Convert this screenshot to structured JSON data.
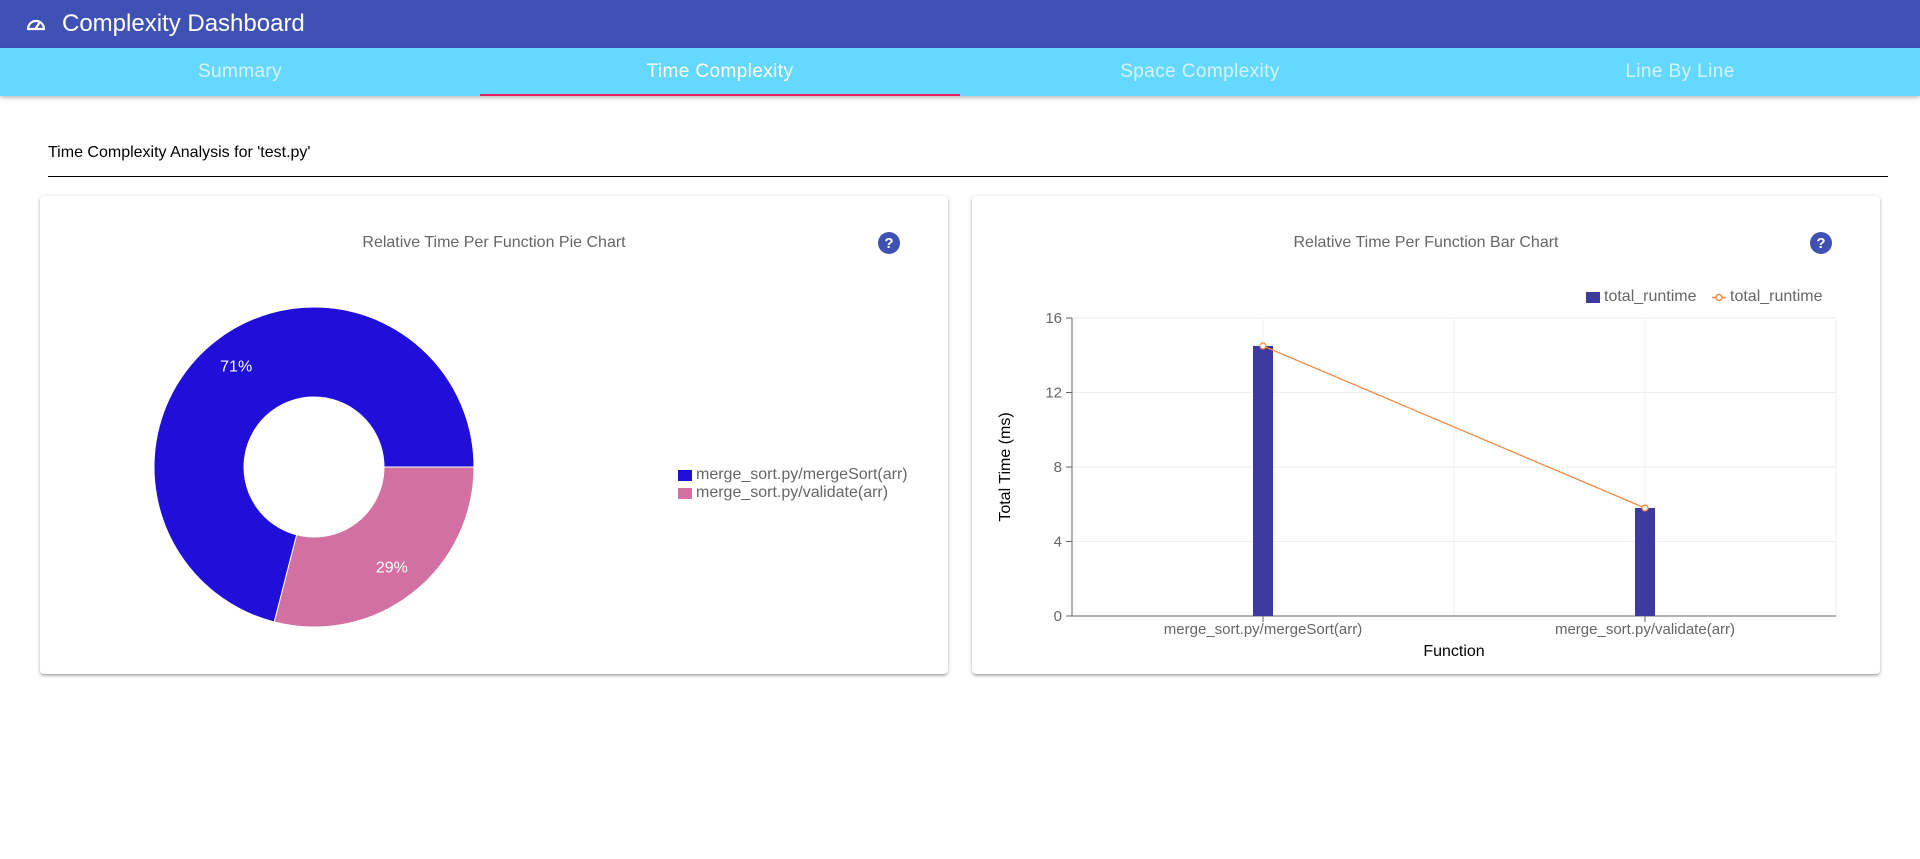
{
  "app": {
    "title": "Complexity Dashboard",
    "icon": "speedometer-icon"
  },
  "tabs": [
    {
      "label": "Summary",
      "active": false
    },
    {
      "label": "Time Complexity",
      "active": true
    },
    {
      "label": "Space Complexity",
      "active": false
    },
    {
      "label": "Line By Line",
      "active": false
    }
  ],
  "page": {
    "heading": "Time Complexity Analysis for 'test.py'"
  },
  "colors": {
    "appbar": "#3f51b5",
    "tabbar": "#64d8fe",
    "tab_indicator": "#e91e63",
    "pie_series_1": "#200fd9",
    "pie_series_2": "#d270a2",
    "bar": "#3d3a9e",
    "line": "#f28a44"
  },
  "pie_card": {
    "title": "Relative Time Per Function Pie Chart",
    "help_label": "?"
  },
  "bar_card": {
    "title": "Relative Time Per Function Bar Chart",
    "help_label": "?"
  },
  "chart_data": [
    {
      "type": "pie",
      "variant": "donut",
      "title": "Relative Time Per Function Pie Chart",
      "slices": [
        {
          "label": "merge_sort.py/mergeSort(arr)",
          "value": 71,
          "display": "71%"
        },
        {
          "label": "merge_sort.py/validate(arr)",
          "value": 29,
          "display": "29%"
        }
      ],
      "legend_position": "right"
    },
    {
      "type": "bar",
      "title": "Relative Time Per Function Bar Chart",
      "categories": [
        "merge_sort.py/mergeSort(arr)",
        "merge_sort.py/validate(arr)"
      ],
      "series": [
        {
          "name": "total_runtime",
          "kind": "bar",
          "values": [
            14.5,
            5.8
          ]
        },
        {
          "name": "total_runtime",
          "kind": "line",
          "values": [
            14.5,
            5.8
          ]
        }
      ],
      "xlabel": "Function",
      "ylabel": "Total Time (ms)",
      "ylim": [
        0,
        16
      ],
      "yticks": [
        "0",
        "4",
        "8",
        "12",
        "16"
      ],
      "grid": true,
      "legend_position": "top-right"
    }
  ]
}
